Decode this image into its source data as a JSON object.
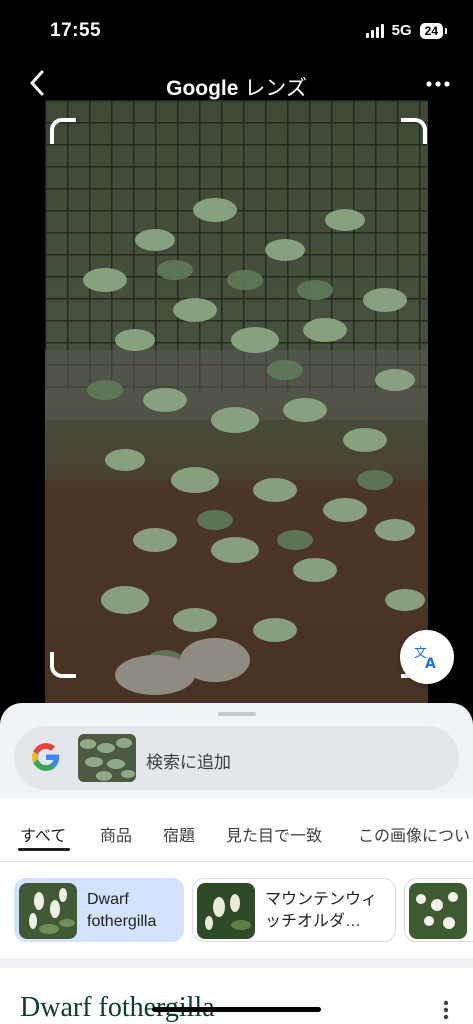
{
  "status": {
    "time": "17:55",
    "network": "5G",
    "battery": "24"
  },
  "header": {
    "title_brand": "Google",
    "title_suffix": "レンズ"
  },
  "search_bar": {
    "label": "検索に追加"
  },
  "tabs": [
    "すべて",
    "商品",
    "宿題",
    "見た目で一致",
    "この画像につい"
  ],
  "chips": [
    {
      "label": "Dwarf fothergilla",
      "selected": true
    },
    {
      "label": "マウンテンウィッチオルダ…",
      "selected": false
    }
  ],
  "result": {
    "title": "Dwarf fothergilla"
  },
  "icons": {
    "back": "chevron-left-icon",
    "more": "more-horizontal-icon",
    "translate": "translate-icon",
    "google": "google-g-logo",
    "result_more": "more-vertical-icon"
  }
}
